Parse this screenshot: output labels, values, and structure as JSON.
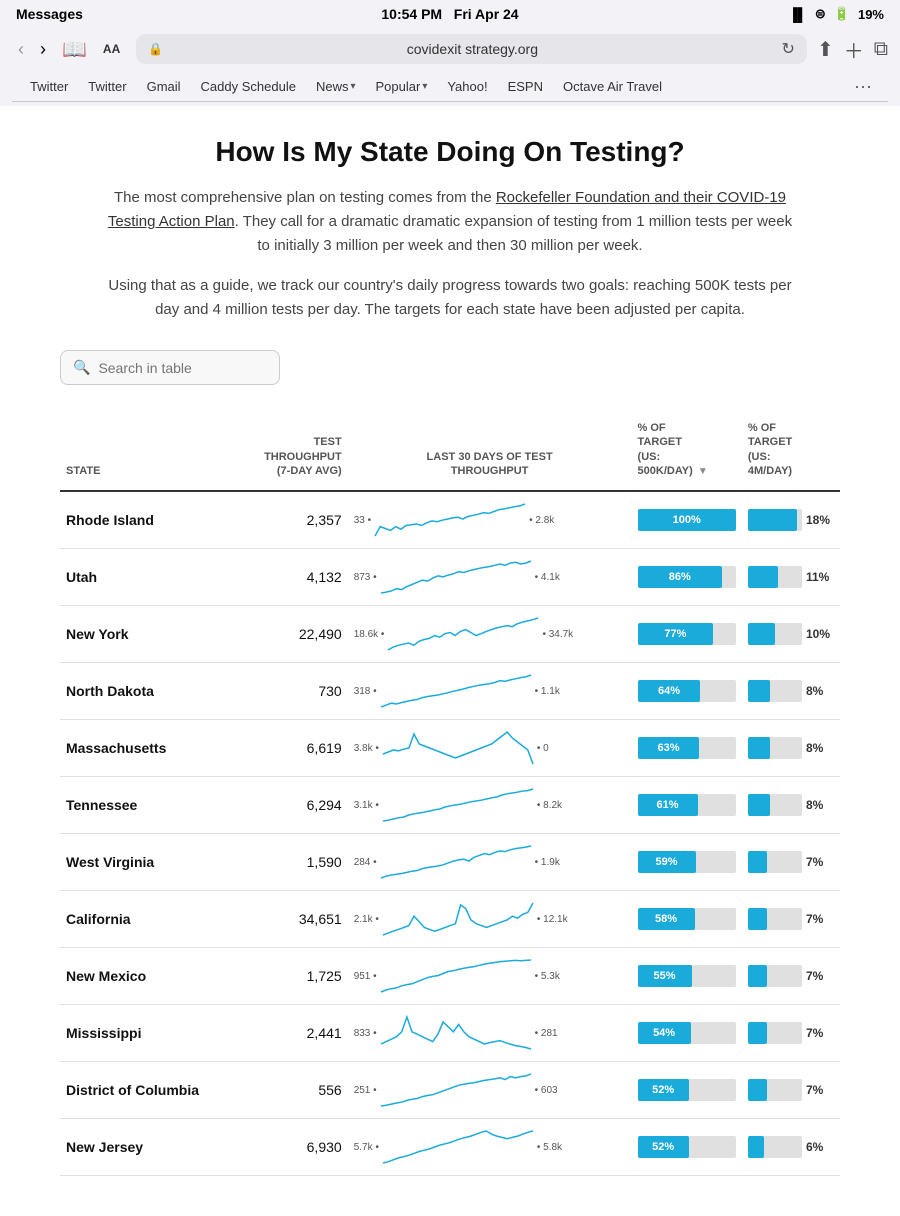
{
  "statusBar": {
    "appName": "Messages",
    "time": "10:54 PM",
    "day": "Fri Apr 24",
    "signal": "signal",
    "wifi": "wifi",
    "battery": "19%"
  },
  "browser": {
    "aaLabel": "AA",
    "url": "covidexit strategy.org",
    "urlFull": "covidexit strategy.org",
    "bookmarks": [
      {
        "label": "Twitter",
        "hasArrow": false
      },
      {
        "label": "Twitter",
        "hasArrow": false
      },
      {
        "label": "Gmail",
        "hasArrow": false
      },
      {
        "label": "Caddy Schedule",
        "hasArrow": false
      },
      {
        "label": "News",
        "hasArrow": true
      },
      {
        "label": "Popular",
        "hasArrow": true
      },
      {
        "label": "Yahoo!",
        "hasArrow": false
      },
      {
        "label": "ESPN",
        "hasArrow": false
      },
      {
        "label": "Octave Air Travel",
        "hasArrow": false
      }
    ],
    "moreLabel": "···"
  },
  "page": {
    "title": "How Is My State Doing On Testing?",
    "desc1": "The most comprehensive plan on testing comes from the Rockefeller Foundation and their COVID-19 Testing Action Plan. They call for a dramatic dramatic expansion of testing from 1 million tests per week to initially 3 million per week and then 30 million per week.",
    "desc2": "Using that as a guide, we track our country's daily progress towards two goals: reaching 500K tests per day and 4 million tests per day. The targets for each state have been adjusted per capita.",
    "searchPlaceholder": "Search in table",
    "tableHeaders": {
      "state": "STATE",
      "throughput": "TEST THROUGHPUT (7-DAY AVG)",
      "last30": "LAST 30 DAYS OF TEST THROUGHPUT",
      "pct500": "% OF TARGET (US: 500K/DAY)",
      "pct4m": "% OF TARGET (US: 4M/DAY)"
    },
    "rows": [
      {
        "state": "Rhode Island",
        "throughput": "2,357",
        "startVal": "33",
        "endVal": "2.8k",
        "pct500": 100,
        "pct500label": "100%",
        "pct4m": 18,
        "pct4mlabel": "18%"
      },
      {
        "state": "Utah",
        "throughput": "4,132",
        "startVal": "873",
        "endVal": "4.1k",
        "pct500": 86,
        "pct500label": "86%",
        "pct4m": 11,
        "pct4mlabel": "11%"
      },
      {
        "state": "New York",
        "throughput": "22,490",
        "startVal": "18.6k",
        "endVal": "34.7k",
        "pct500": 77,
        "pct500label": "77%",
        "pct4m": 10,
        "pct4mlabel": "10%"
      },
      {
        "state": "North Dakota",
        "throughput": "730",
        "startVal": "318",
        "endVal": "1.1k",
        "pct500": 64,
        "pct500label": "64%",
        "pct4m": 8,
        "pct4mlabel": "8%"
      },
      {
        "state": "Massachusetts",
        "throughput": "6,619",
        "startVal": "3.8k",
        "endVal": "0",
        "pct500": 63,
        "pct500label": "63%",
        "pct4m": 8,
        "pct4mlabel": "8%"
      },
      {
        "state": "Tennessee",
        "throughput": "6,294",
        "startVal": "3.1k",
        "endVal": "8.2k",
        "pct500": 61,
        "pct500label": "61%",
        "pct4m": 8,
        "pct4mlabel": "8%"
      },
      {
        "state": "West Virginia",
        "throughput": "1,590",
        "startVal": "284",
        "endVal": "1.9k",
        "pct500": 59,
        "pct500label": "59%",
        "pct4m": 7,
        "pct4mlabel": "7%"
      },
      {
        "state": "California",
        "throughput": "34,651",
        "startVal": "2.1k",
        "endVal": "12.1k",
        "pct500": 58,
        "pct500label": "58%",
        "pct4m": 7,
        "pct4mlabel": "7%"
      },
      {
        "state": "New Mexico",
        "throughput": "1,725",
        "startVal": "951",
        "endVal": "5.3k",
        "pct500": 55,
        "pct500label": "55%",
        "pct4m": 7,
        "pct4mlabel": "7%"
      },
      {
        "state": "Mississippi",
        "throughput": "2,441",
        "startVal": "833",
        "endVal": "281",
        "pct500": 54,
        "pct500label": "54%",
        "pct4m": 7,
        "pct4mlabel": "7%"
      },
      {
        "state": "District of Columbia",
        "throughput": "556",
        "startVal": "251",
        "endVal": "603",
        "pct500": 52,
        "pct500label": "52%",
        "pct4m": 7,
        "pct4mlabel": "7%"
      },
      {
        "state": "New Jersey",
        "throughput": "6,930",
        "startVal": "5.7k",
        "endVal": "5.8k",
        "pct500": 52,
        "pct500label": "52%",
        "pct4m": 6,
        "pct4mlabel": "6%"
      }
    ]
  }
}
